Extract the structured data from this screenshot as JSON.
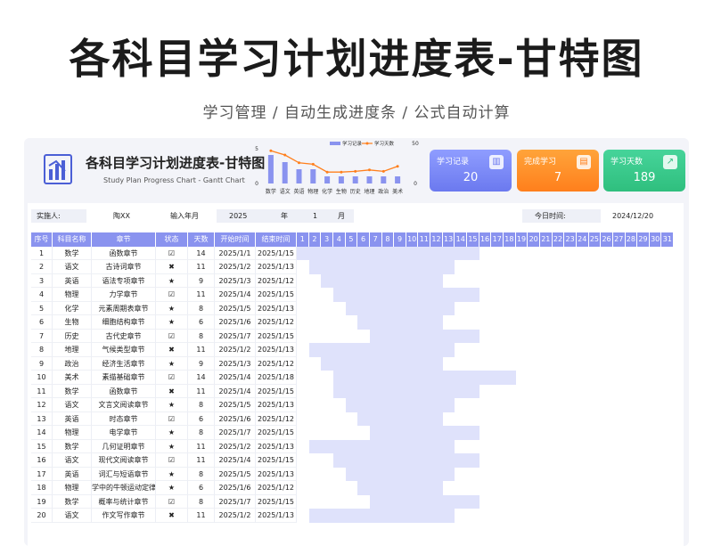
{
  "hero": {
    "title": "各科目学习计划进度表-甘特图",
    "subtitle": "学习管理  /  自动生成进度条  /  公式自动计算"
  },
  "sheet": {
    "title": "各科目学习计划进度表-甘特图",
    "subtitle_en": "Study Plan Progress Chart - Gantt Chart"
  },
  "chart_data": {
    "type": "bar",
    "categories": [
      "数学",
      "语文",
      "英语",
      "物理",
      "化学",
      "生物",
      "历史",
      "地理",
      "政治",
      "美术"
    ],
    "series": [
      {
        "name": "学习记录",
        "type": "bar",
        "axis": "left",
        "values": [
          4,
          3,
          2,
          2,
          1,
          1,
          1,
          1,
          1,
          1
        ],
        "color": "#8a93ef"
      },
      {
        "name": "学习天数",
        "type": "line",
        "axis": "right",
        "values": [
          46,
          40,
          29,
          27,
          16,
          16,
          17,
          19,
          17,
          24
        ],
        "color": "#ff7f1c"
      }
    ],
    "yaxis_left": {
      "ticks": [
        "5",
        "0"
      ],
      "ylim": [
        0,
        5
      ]
    },
    "yaxis_right": {
      "ticks": [
        "50",
        "0"
      ],
      "ylim": [
        0,
        50
      ]
    },
    "legend": "top"
  },
  "cards": [
    {
      "label": "学习记录",
      "value": "20",
      "icon": "bar-chart-icon"
    },
    {
      "label": "完成学习",
      "value": "7",
      "icon": "document-icon"
    },
    {
      "label": "学习天数",
      "value": "189",
      "icon": "trend-icon"
    }
  ],
  "info": {
    "implementer_label": "实施人:",
    "implementer": "陶XX",
    "input_label": "输入年月",
    "year": "2025",
    "year_unit": "年",
    "month": "1",
    "month_unit": "月",
    "today_label": "今日时间:",
    "today": "2024/12/20"
  },
  "table": {
    "headers": [
      "序号",
      "科目名称",
      "章节",
      "状态",
      "天数",
      "开始时间",
      "结束时间"
    ],
    "days": [
      "1",
      "2",
      "3",
      "4",
      "5",
      "6",
      "7",
      "8",
      "9",
      "10",
      "11",
      "12",
      "13",
      "14",
      "15",
      "16",
      "17",
      "18",
      "19",
      "20",
      "21",
      "22",
      "23",
      "24",
      "25",
      "26",
      "27",
      "28",
      "29",
      "30",
      "31"
    ],
    "rows": [
      {
        "no": "1",
        "subject": "数学",
        "chapter": "函数章节",
        "status": "☑",
        "days": "14",
        "start": "2025/1/1",
        "end": "2025/1/15",
        "start_day": 1,
        "end_day": 15
      },
      {
        "no": "2",
        "subject": "语文",
        "chapter": "古诗词章节",
        "status": "✖",
        "days": "11",
        "start": "2025/1/2",
        "end": "2025/1/13",
        "start_day": 2,
        "end_day": 13
      },
      {
        "no": "3",
        "subject": "英语",
        "chapter": "语法专项章节",
        "status": "★",
        "days": "9",
        "start": "2025/1/3",
        "end": "2025/1/12",
        "start_day": 3,
        "end_day": 12
      },
      {
        "no": "4",
        "subject": "物理",
        "chapter": "力学章节",
        "status": "☑",
        "days": "11",
        "start": "2025/1/4",
        "end": "2025/1/15",
        "start_day": 4,
        "end_day": 15
      },
      {
        "no": "5",
        "subject": "化学",
        "chapter": "元素周期表章节",
        "status": "★",
        "days": "8",
        "start": "2025/1/5",
        "end": "2025/1/13",
        "start_day": 5,
        "end_day": 13
      },
      {
        "no": "6",
        "subject": "生物",
        "chapter": "细胞结构章节",
        "status": "★",
        "days": "6",
        "start": "2025/1/6",
        "end": "2025/1/12",
        "start_day": 6,
        "end_day": 12
      },
      {
        "no": "7",
        "subject": "历史",
        "chapter": "古代史章节",
        "status": "☑",
        "days": "8",
        "start": "2025/1/7",
        "end": "2025/1/15",
        "start_day": 7,
        "end_day": 15
      },
      {
        "no": "8",
        "subject": "地理",
        "chapter": "气候类型章节",
        "status": "✖",
        "days": "11",
        "start": "2025/1/2",
        "end": "2025/1/13",
        "start_day": 2,
        "end_day": 13
      },
      {
        "no": "9",
        "subject": "政治",
        "chapter": "经济生活章节",
        "status": "★",
        "days": "9",
        "start": "2025/1/3",
        "end": "2025/1/12",
        "start_day": 3,
        "end_day": 12
      },
      {
        "no": "10",
        "subject": "美术",
        "chapter": "素描基础章节",
        "status": "☑",
        "days": "14",
        "start": "2025/1/4",
        "end": "2025/1/18",
        "start_day": 4,
        "end_day": 18
      },
      {
        "no": "11",
        "subject": "数学",
        "chapter": "函数章节",
        "status": "✖",
        "days": "11",
        "start": "2025/1/4",
        "end": "2025/1/15",
        "start_day": 4,
        "end_day": 15
      },
      {
        "no": "12",
        "subject": "语文",
        "chapter": "文言文阅读章节",
        "status": "★",
        "days": "8",
        "start": "2025/1/5",
        "end": "2025/1/13",
        "start_day": 5,
        "end_day": 13
      },
      {
        "no": "13",
        "subject": "英语",
        "chapter": "时态章节",
        "status": "☑",
        "days": "6",
        "start": "2025/1/6",
        "end": "2025/1/12",
        "start_day": 6,
        "end_day": 12
      },
      {
        "no": "14",
        "subject": "物理",
        "chapter": "电学章节",
        "status": "★",
        "days": "8",
        "start": "2025/1/7",
        "end": "2025/1/15",
        "start_day": 7,
        "end_day": 15
      },
      {
        "no": "15",
        "subject": "数学",
        "chapter": "几何证明章节",
        "status": "★",
        "days": "11",
        "start": "2025/1/2",
        "end": "2025/1/13",
        "start_day": 2,
        "end_day": 13
      },
      {
        "no": "16",
        "subject": "语文",
        "chapter": "现代文阅读章节",
        "status": "☑",
        "days": "11",
        "start": "2025/1/4",
        "end": "2025/1/15",
        "start_day": 4,
        "end_day": 15
      },
      {
        "no": "17",
        "subject": "英语",
        "chapter": "词汇与短语章节",
        "status": "★",
        "days": "8",
        "start": "2025/1/5",
        "end": "2025/1/13",
        "start_day": 5,
        "end_day": 13
      },
      {
        "no": "18",
        "subject": "物理",
        "chapter": "学中的牛顿运动定律章",
        "status": "★",
        "days": "6",
        "start": "2025/1/6",
        "end": "2025/1/12",
        "start_day": 6,
        "end_day": 12
      },
      {
        "no": "19",
        "subject": "数学",
        "chapter": "概率与统计章节",
        "status": "☑",
        "days": "8",
        "start": "2025/1/7",
        "end": "2025/1/15",
        "start_day": 7,
        "end_day": 15
      },
      {
        "no": "20",
        "subject": "语文",
        "chapter": "作文写作章节",
        "status": "✖",
        "days": "11",
        "start": "2025/1/2",
        "end": "2025/1/13",
        "start_day": 2,
        "end_day": 13
      }
    ]
  }
}
